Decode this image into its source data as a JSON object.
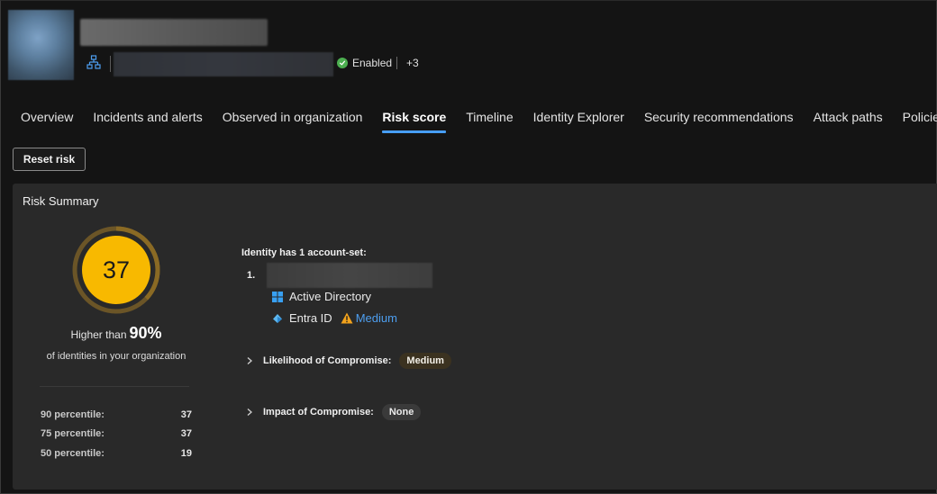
{
  "header": {
    "status_label": "Enabled",
    "extra_count": "+3"
  },
  "tabs": [
    {
      "label": "Overview"
    },
    {
      "label": "Incidents and alerts"
    },
    {
      "label": "Observed in organization"
    },
    {
      "label": "Risk score"
    },
    {
      "label": "Timeline"
    },
    {
      "label": "Identity Explorer"
    },
    {
      "label": "Security recommendations"
    },
    {
      "label": "Attack paths"
    },
    {
      "label": "Policies"
    }
  ],
  "active_tab": "Risk score",
  "toolbar": {
    "reset_label": "Reset risk"
  },
  "risk_summary": {
    "title": "Risk Summary",
    "score": "37",
    "score_fraction": 0.37,
    "higher_than_prefix": "Higher than",
    "higher_than_pct": "90%",
    "of_identities": "of identities in your organization",
    "percentiles": [
      {
        "label": "90 percentile:",
        "value": "37"
      },
      {
        "label": "75 percentile:",
        "value": "37"
      },
      {
        "label": "50 percentile:",
        "value": "19"
      }
    ]
  },
  "accounts": {
    "heading": "Identity has 1 account-set:",
    "item_number": "1.",
    "sources": [
      {
        "label": "Active Directory",
        "icon": "windows-icon"
      },
      {
        "label": "Entra ID",
        "icon": "entra-id-icon",
        "risk": "Medium"
      }
    ]
  },
  "likelihood": {
    "label": "Likelihood of Compromise:",
    "value": "Medium"
  },
  "impact": {
    "label": "Impact of Compromise:",
    "value": "None"
  },
  "colors": {
    "accent": "#479ef5",
    "score_fill": "#f8b900",
    "enabled": "#4caf50",
    "warning": "#f3a31c",
    "link": "#4d9eef"
  }
}
